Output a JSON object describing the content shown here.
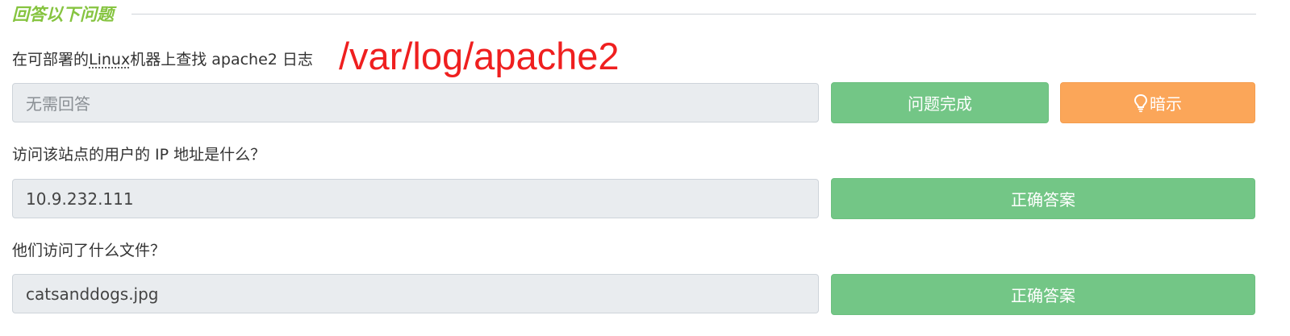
{
  "section": {
    "title": "回答以下问题"
  },
  "annotation": "/var/log/apache2",
  "questions": [
    {
      "prefix": "在可部署的",
      "link": "Linux",
      "suffix": "机器上查找 apache2 日志",
      "answer_placeholder": "无需回答",
      "buttons": {
        "complete": "问题完成",
        "hint": "暗示"
      }
    },
    {
      "text": "访问该站点的用户的 IP 地址是什么？",
      "answer_value": "10.9.232.111",
      "button": "正确答案"
    },
    {
      "text": "他们访问了什么文件？",
      "answer_value": "catsanddogs.jpg",
      "button": "正确答案"
    }
  ],
  "colors": {
    "success": "#73c686",
    "hint": "#fba659",
    "title": "#86c440",
    "annotation": "#ef1f1f"
  },
  "icons": {
    "hint": "lightbulb-icon"
  }
}
